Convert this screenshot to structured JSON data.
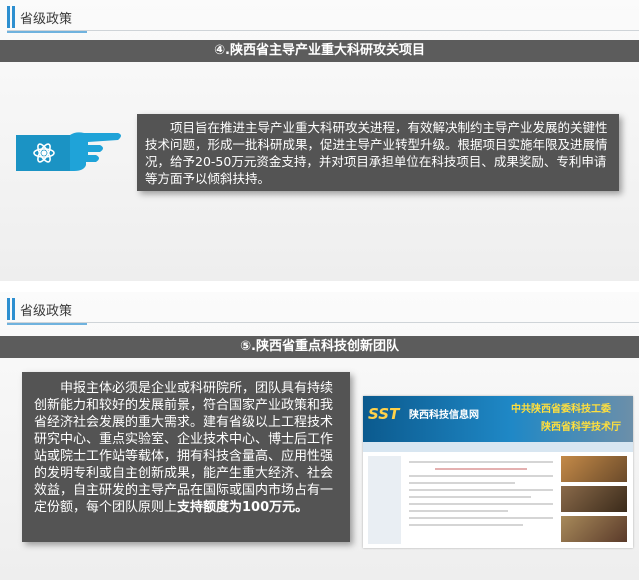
{
  "slide1": {
    "tag": "省级政策",
    "banner": "④.陕西省主导产业重大科研攻关项目",
    "body": "项目旨在推进主导产业重大科研攻关进程，有效解决制约主导产业发展的关键性技术问题，形成一批科研成果，促进主导产业转型升级。根据项目实施年限及进展情况，给予20-50万元资金支持，并对项目承担单位在科技项目、成果奖励、专利申请等方面予以倾斜扶持。"
  },
  "slide2": {
    "tag": "省级政策",
    "banner": "⑤.陕西省重点科技创新团队",
    "body": "申报主体必须是企业或科研院所，团队具有持续创新能力和较好的发展前景，符合国家产业政策和我省经济社会发展的重大需求。建有省级以上工程技术研究中心、重点实验室、企业技术中心、博士后工作站或院士工作站等载体，拥有科技含量高、应用性强的发明专利或自主创新成果，能产生重大经济、社会效益，自主研发的主导产品在国际或国内市场占有一定份额，每个团队原则上",
    "body_bold": "支持额度为100万元。",
    "website": {
      "logo": "SST",
      "title": "陕西科技信息网",
      "slogan1": "中共陕西省委科技工委",
      "slogan2": "陕西省科学技术厅"
    }
  },
  "colors": {
    "accent": "#2d8fd0",
    "banner_bg": "#5c5c5c",
    "box_bg": "#545454",
    "hand": "#1fa3d8"
  },
  "icons": {
    "hand": "pointing-hand-icon",
    "atom": "atom-icon"
  }
}
